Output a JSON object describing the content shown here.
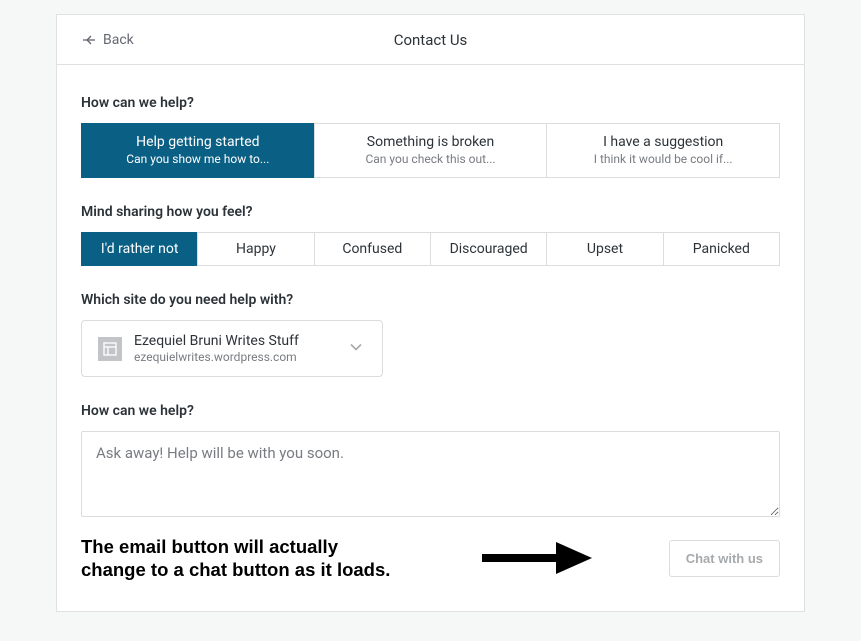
{
  "header": {
    "back_label": "Back",
    "title": "Contact Us"
  },
  "help_category": {
    "question": "How can we help?",
    "options": [
      {
        "title": "Help getting started",
        "subtitle": "Can you show me how to...",
        "selected": true
      },
      {
        "title": "Something is broken",
        "subtitle": "Can you check this out...",
        "selected": false
      },
      {
        "title": "I have a suggestion",
        "subtitle": "I think it would be cool if...",
        "selected": false
      }
    ]
  },
  "mood": {
    "question": "Mind sharing how you feel?",
    "options": [
      "I'd rather not",
      "Happy",
      "Confused",
      "Discouraged",
      "Upset",
      "Panicked"
    ],
    "selected_index": 0
  },
  "site": {
    "question": "Which site do you need help with?",
    "name": "Ezequiel Bruni Writes Stuff",
    "url": "ezequielwrites.wordpress.com"
  },
  "message": {
    "question": "How can we help?",
    "placeholder": "Ask away! Help will be with you soon."
  },
  "footer": {
    "annotation_line1": "The email button will actually",
    "annotation_line2": "change to a chat button as it loads.",
    "button_label": "Chat with us"
  }
}
